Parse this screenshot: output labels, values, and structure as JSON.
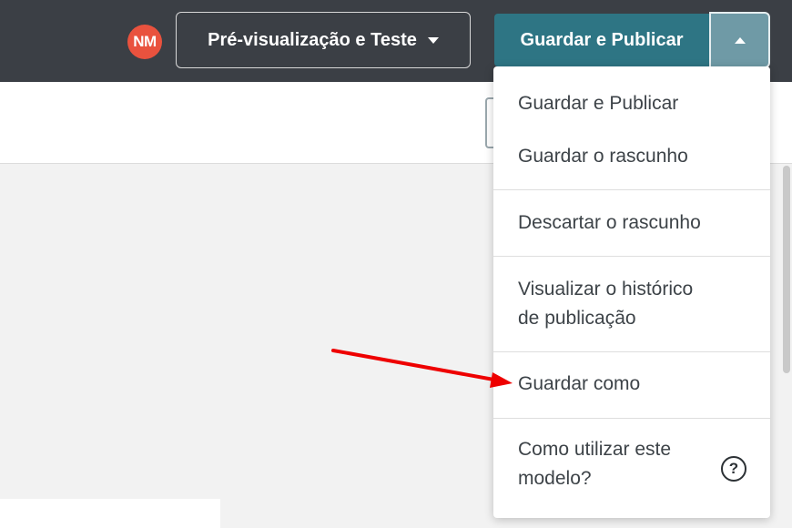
{
  "header": {
    "avatar_initials": "NM",
    "preview_label": "Pré-visualização e Teste",
    "publish_label": "Guardar e Publicar"
  },
  "dropdown": {
    "items": [
      {
        "label": "Guardar e Publicar"
      },
      {
        "label": "Guardar o rascunho"
      },
      {
        "label": "Descartar o rascunho"
      },
      {
        "label": "Visualizar o histórico de publicação"
      },
      {
        "label": "Guardar como"
      },
      {
        "label": "Como utilizar este modelo?"
      }
    ],
    "help_icon": "question-circle-icon"
  },
  "colors": {
    "topbar": "#3b3f45",
    "accent": "#2e7584",
    "avatar": "#e9523e",
    "annotation_arrow": "#ee0000"
  }
}
